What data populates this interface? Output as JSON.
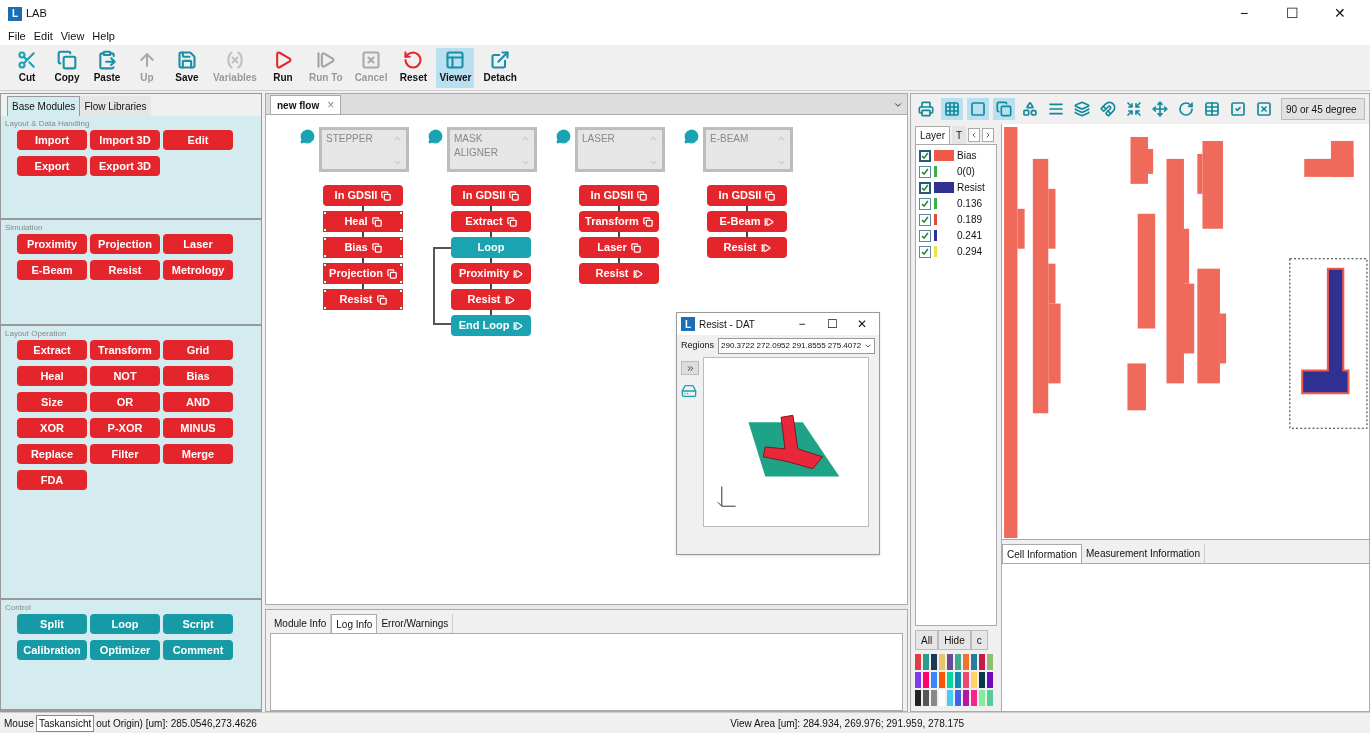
{
  "window": {
    "logo": "L",
    "title": "LAB",
    "controls": [
      "−",
      "☐",
      "✕"
    ]
  },
  "menu": [
    "File",
    "Edit",
    "View",
    "Help"
  ],
  "toolbar": [
    {
      "label": "Cut",
      "kind": "cut",
      "disabled": false,
      "selected": false
    },
    {
      "label": "Copy",
      "kind": "copy",
      "disabled": false,
      "selected": false
    },
    {
      "label": "Paste",
      "kind": "paste",
      "disabled": false,
      "selected": false
    },
    {
      "label": "Up",
      "kind": "up",
      "disabled": true,
      "selected": false
    },
    {
      "label": "Save",
      "kind": "save",
      "disabled": false,
      "selected": false
    },
    {
      "label": "Variables",
      "kind": "variables",
      "disabled": true,
      "selected": false
    },
    {
      "label": "Run",
      "kind": "run",
      "disabled": false,
      "selected": false
    },
    {
      "label": "Run To",
      "kind": "runto",
      "disabled": true,
      "selected": false
    },
    {
      "label": "Cancel",
      "kind": "cancel",
      "disabled": true,
      "selected": false
    },
    {
      "label": "Reset",
      "kind": "reset",
      "disabled": false,
      "selected": false
    },
    {
      "label": "Viewer",
      "kind": "viewer",
      "disabled": false,
      "selected": true
    },
    {
      "label": "Detach",
      "kind": "detach",
      "disabled": false,
      "selected": false
    }
  ],
  "left_panel": {
    "tabs": [
      {
        "label": "Base Modules",
        "selected": true
      },
      {
        "label": "Flow Libraries",
        "selected": false
      }
    ],
    "sections": [
      {
        "title": "Layout & Data Handling",
        "kind": "module",
        "buttons": [
          "Import",
          "Import 3D",
          "Edit",
          "Export",
          "Export 3D"
        ]
      },
      {
        "title": "Simulation",
        "kind": "module",
        "buttons": [
          "Proximity",
          "Projection",
          "Laser",
          "E-Beam",
          "Resist",
          "Metrology"
        ]
      },
      {
        "title": "Layout Operation",
        "kind": "module",
        "buttons": [
          "Extract",
          "Transform",
          "Grid",
          "Heal",
          "NOT",
          "Bias",
          "Size",
          "OR",
          "AND",
          "XOR",
          "P-XOR",
          "MINUS",
          "Replace",
          "Filter",
          "Merge",
          "FDA"
        ]
      },
      {
        "title": "Control",
        "kind": "control",
        "buttons": [
          "Split",
          "Loop",
          "Script",
          "Calibration",
          "Optimizer",
          "Comment"
        ]
      }
    ]
  },
  "flow_editor": {
    "tabs": [
      {
        "label": "new flow",
        "close": "×",
        "selected": true
      }
    ],
    "flows": [
      {
        "title": "STEPPER",
        "blocks": [
          {
            "label": "In GDSII",
            "kind": "module",
            "selected": false
          },
          {
            "label": "Heal",
            "kind": "module",
            "selected": true
          },
          {
            "label": "Bias",
            "kind": "module",
            "selected": true
          },
          {
            "label": "Projection",
            "kind": "module",
            "selected": true
          },
          {
            "label": "Resist",
            "kind": "module",
            "selected": true
          }
        ]
      },
      {
        "title": "MASK ALIGNER",
        "blocks": [
          {
            "label": "In GDSII",
            "kind": "module",
            "selected": false
          },
          {
            "label": "Extract",
            "kind": "module",
            "selected": false
          },
          {
            "label": "Loop",
            "kind": "loop",
            "selected": false
          },
          {
            "label": "Proximity",
            "kind": "task",
            "selected": false
          },
          {
            "label": "Resist",
            "kind": "task",
            "selected": false
          },
          {
            "label": "End Loop",
            "kind": "loopend",
            "selected": false
          }
        ]
      },
      {
        "title": "LASER",
        "blocks": [
          {
            "label": "In GDSII",
            "kind": "module",
            "selected": false
          },
          {
            "label": "Transform",
            "kind": "module",
            "selected": false
          },
          {
            "label": "Laser",
            "kind": "module",
            "selected": false
          },
          {
            "label": "Resist",
            "kind": "task",
            "selected": false
          }
        ]
      },
      {
        "title": "E-BEAM",
        "blocks": [
          {
            "label": "In GDSII",
            "kind": "module",
            "selected": false
          },
          {
            "label": "E-Beam",
            "kind": "task",
            "selected": false
          },
          {
            "label": "Resist",
            "kind": "task",
            "selected": false
          }
        ]
      }
    ],
    "dialog": {
      "logo": "L",
      "title": "Resist - DAT",
      "controls": [
        "−",
        "☐",
        "✕"
      ],
      "regions_label": "Regions",
      "regions_value": "290.3722 272.0952 291.8555 275.4072"
    },
    "bottom_tabs": [
      {
        "label": "Module Info",
        "selected": false
      },
      {
        "label": "Log Info",
        "selected": true
      },
      {
        "label": "Error/Warnings",
        "selected": false
      }
    ]
  },
  "layout_viewer": {
    "tools": [
      {
        "kind": "printer",
        "selected": false
      },
      {
        "kind": "grid",
        "selected": true
      },
      {
        "kind": "square",
        "selected": true
      },
      {
        "kind": "copy",
        "selected": true
      },
      {
        "kind": "shapes",
        "selected": false
      },
      {
        "kind": "lines",
        "selected": false
      },
      {
        "kind": "layers",
        "selected": false
      },
      {
        "kind": "magnet",
        "selected": false
      },
      {
        "kind": "shrink",
        "selected": false
      },
      {
        "kind": "move",
        "selected": false
      },
      {
        "kind": "rotate",
        "selected": false
      },
      {
        "kind": "table",
        "selected": false
      },
      {
        "kind": "check",
        "selected": false
      },
      {
        "kind": "cross",
        "selected": false
      }
    ],
    "snap_mode": "90 or 45 degree",
    "layer_tabs": [
      {
        "label": "Layer",
        "selected": true
      },
      {
        "label": "T",
        "selected": false
      }
    ],
    "layers": [
      {
        "name": "Bias",
        "kind": "layer",
        "checked": true,
        "color": "#ef5a48"
      },
      {
        "name": "0(0)",
        "kind": "datatype",
        "checked": true,
        "color": "#3cae4a"
      },
      {
        "name": "Resist",
        "kind": "layer",
        "checked": true,
        "color": "#2e3192"
      },
      {
        "name": "0.136",
        "kind": "datatype",
        "checked": true,
        "color": "#3cae4a"
      },
      {
        "name": "0.189",
        "kind": "datatype",
        "checked": true,
        "color": "#e8473a"
      },
      {
        "name": "0.241",
        "kind": "datatype",
        "checked": true,
        "color": "#2e3192"
      },
      {
        "name": "0.294",
        "kind": "datatype",
        "checked": true,
        "color": "#f0e04a"
      }
    ],
    "layer_buttons": [
      "All",
      "Hide",
      "c"
    ],
    "info_tabs": [
      {
        "label": "Cell Information",
        "selected": true
      },
      {
        "label": "Measurement Information",
        "selected": false
      }
    ]
  },
  "status_bar": {
    "mouse_label": "Mouse",
    "tooltip": "Taskansicht",
    "mouse_position": "out Origin) [um]: 285.0546,273.4626",
    "view_area": "View Area [um]: 284.934, 269.976; 291.959, 278.175"
  }
}
